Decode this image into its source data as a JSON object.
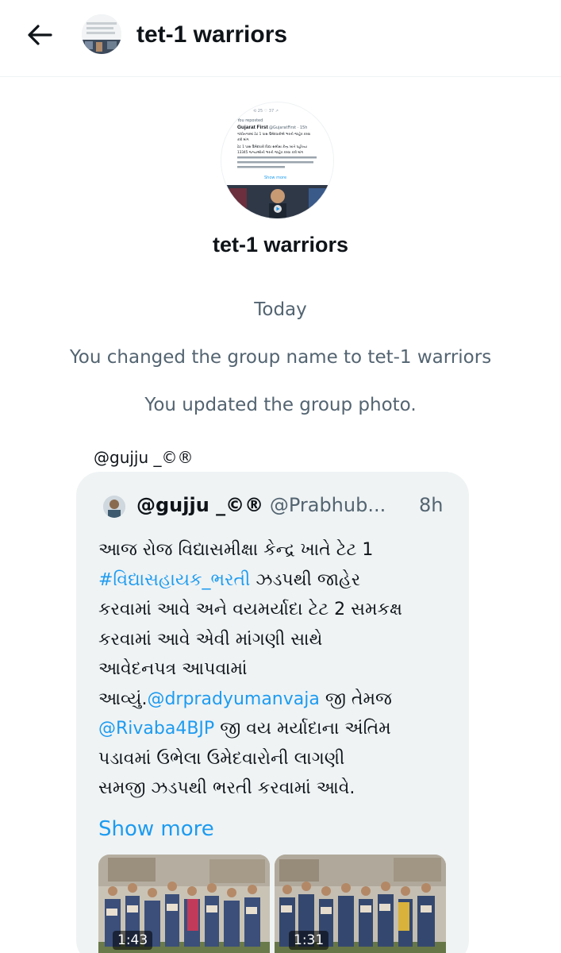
{
  "header": {
    "title": "tet-1 warriors",
    "back_icon": "arrow-left-icon"
  },
  "group": {
    "name": "tet-1 warriors",
    "photo_preview": {
      "top_text": "You reposted",
      "account": "Gujarat First",
      "handle": "@GujaratFirst · 15h",
      "lines": [
        "ગાંધીનગરમાં ટેટ 1 પાસ ઉમેદવારોએ ભરતી જાહેર કરવા",
        "કરી માંગ",
        "ટેટ 1 પાસ ઉમેદવારો વિદ્યા સમીક્ષા કેન્દ્ર ખાતે પહોંચ્યા",
        "13345 જગ્યાઓની ભરતી જાહેર કરવા કરી માંગ"
      ],
      "show_more": "Show more"
    }
  },
  "system_messages": {
    "today": "Today",
    "name_change": "You changed the group name to tet-1 warriors",
    "photo_update": "You updated the group photo."
  },
  "message": {
    "sender": "@gujju _©®",
    "tweet": {
      "author": "@gujju _©®",
      "handle": "@Prabhub...",
      "time": "8h",
      "lines": [
        [
          {
            "t": "આજ રોજ વિદ્યાસમીક્ષા કેન્દ્ર ખાતે ટેટ 1",
            "link": false
          }
        ],
        [
          {
            "t": "#વિદ્યાસહાયક_ભરતી",
            "link": true
          },
          {
            "t": " ઝડપથી જાહેર",
            "link": false
          }
        ],
        [
          {
            "t": "કરવામાં આવે અને વયમર્યાદા ટેટ 2 સમકક્ષ",
            "link": false
          }
        ],
        [
          {
            "t": "કરવામાં આવે એવી માંગણી સાથે",
            "link": false
          }
        ],
        [
          {
            "t": "આવેદનપત્ર આપવામાં",
            "link": false
          }
        ],
        [
          {
            "t": "આવ્યું.",
            "link": false
          },
          {
            "t": "@drpradyumanvaja",
            "link": true
          },
          {
            "t": " જી તેમજ",
            "link": false
          }
        ],
        [
          {
            "t": "@Rivaba4BJP",
            "link": true
          },
          {
            "t": " જી વય મર્યાદાના અંતિમ",
            "link": false
          }
        ],
        [
          {
            "t": "પડાવમાં ઉભેલા ઉમેદવારોની લાગણી",
            "link": false
          }
        ],
        [
          {
            "t": "સમજી ઝડપથી ભરતી કરવામાં આવે.",
            "link": false
          }
        ]
      ],
      "show_more": "Show more",
      "videos": [
        {
          "duration": "1:43"
        },
        {
          "duration": "1:31"
        }
      ]
    }
  }
}
